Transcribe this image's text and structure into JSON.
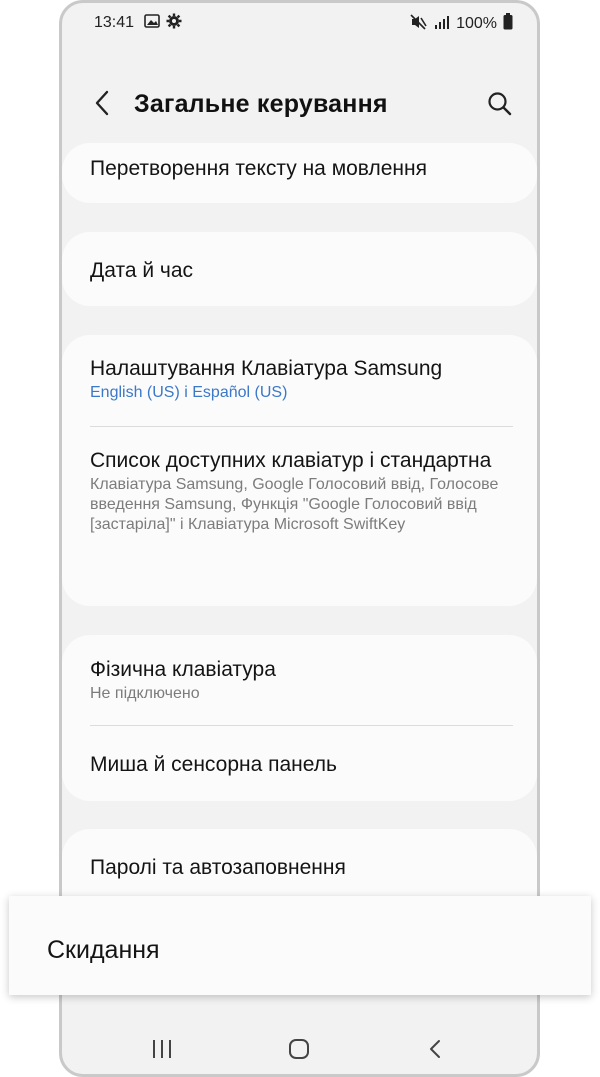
{
  "status_bar": {
    "time": "13:41",
    "battery": "100%"
  },
  "header": {
    "title": "Загальне керування"
  },
  "items": {
    "tts": {
      "title": "Перетворення тексту на мовлення"
    },
    "date_time": {
      "title": "Дата й час"
    },
    "samsung_keyboard": {
      "title": "Налаштування Клавіатура Samsung",
      "subtitle": "English (US) і Español (US)"
    },
    "keyboard_list": {
      "title": "Список доступних клавіатур і стандартна",
      "subtitle": "Клавіатура Samsung, Google Голосовий ввід, Голосове введення Samsung, Функція \"Google Голосовий ввід [застаріла]\" і Клавіатура Microsoft SwiftKey"
    },
    "physical_keyboard": {
      "title": "Фізична клавіатура",
      "subtitle": "Не підключено"
    },
    "mouse_touchpad": {
      "title": "Миша й сенсорна панель"
    },
    "passwords_autofill": {
      "title": "Паролі та автозаповнення"
    }
  },
  "highlight": {
    "label": "Скидання"
  },
  "icons": [
    "gallery-icon",
    "gear-icon",
    "mute-icon",
    "signal-icon",
    "battery-icon",
    "back-arrow-icon",
    "search-icon",
    "recents-icon",
    "home-icon",
    "nav-back-icon"
  ],
  "colors": {
    "background": "#f2f2f2",
    "card": "#fbfbfb",
    "accent_subtitle": "#3b78c8"
  }
}
